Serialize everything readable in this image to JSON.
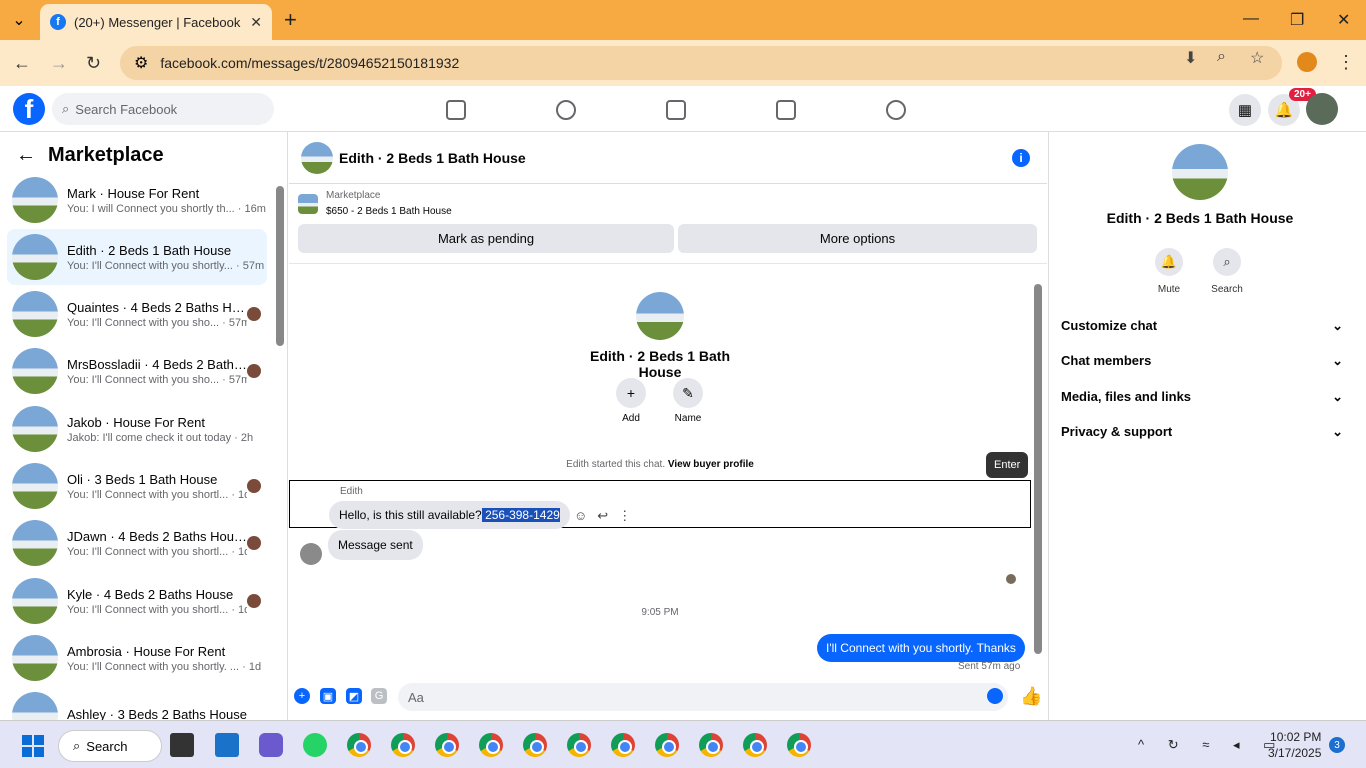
{
  "browser": {
    "tab_title": "(20+) Messenger | Facebook",
    "url": "facebook.com/messages/t/28094652150181932"
  },
  "header": {
    "search_placeholder": "Search Facebook",
    "notif_badge": "20+"
  },
  "left": {
    "title": "Marketplace",
    "convos": [
      {
        "name": "Mark · House For Rent",
        "preview": "You: I will Connect you shortly th... · 16m"
      },
      {
        "name": "Edith · 2 Beds 1 Bath House",
        "preview": "You: I'll Connect with you shortly... · 57m"
      },
      {
        "name": "Quaintes · 4 Beds 2 Baths Ho...",
        "preview": "You: I'll Connect with you sho... · 57m"
      },
      {
        "name": "MrsBossladii · 4 Beds 2 Baths ...",
        "preview": "You: I'll Connect with you sho... · 57m"
      },
      {
        "name": "Jakob · House For Rent",
        "preview": "Jakob: I'll come check it out today · 2h"
      },
      {
        "name": "Oli · 3 Beds 1 Bath House",
        "preview": "You: I'll Connect with you shortl... · 1d"
      },
      {
        "name": "JDawn · 4 Beds 2 Baths House",
        "preview": "You: I'll Connect with you shortl... · 1d"
      },
      {
        "name": "Kyle · 4 Beds 2 Baths House",
        "preview": "You: I'll Connect with you shortl... · 1d"
      },
      {
        "name": "Ambrosia · House For Rent",
        "preview": "You: I'll Connect with you shortly. ... · 1d"
      },
      {
        "name": "Ashley · 3 Beds 2 Baths House",
        "preview": ""
      }
    ]
  },
  "chat": {
    "title": "Edith · 2 Beds 1 Bath House",
    "marketplace_label": "Marketplace",
    "listing": "$650 - 2 Beds 1 Bath House",
    "mark_pending": "Mark as pending",
    "more_options": "More options",
    "profile_name": "Edith · 2 Beds 1 Bath House",
    "add_label": "Add",
    "name_label": "Name",
    "started_text": "Edith started this chat.",
    "view_buyer": "View buyer profile",
    "enter_tooltip": "Enter",
    "sender": "Edith",
    "msg1_text": "Hello, is this still available?",
    "msg1_selected": " 256-398-1429",
    "msg2": "Message sent",
    "time_sep": "9:05 PM",
    "msg3": "I'll Connect with you shortly. Thanks",
    "sent_status": "Sent 57m ago",
    "composer_placeholder": "Aa"
  },
  "right": {
    "name": "Edith · 2 Beds 1 Bath House",
    "mute": "Mute",
    "search": "Search",
    "sections": [
      "Customize chat",
      "Chat members",
      "Media, files and links",
      "Privacy & support"
    ]
  },
  "taskbar": {
    "search": "Search",
    "time": "10:02 PM",
    "date": "3/17/2025",
    "notif_count": "3"
  }
}
